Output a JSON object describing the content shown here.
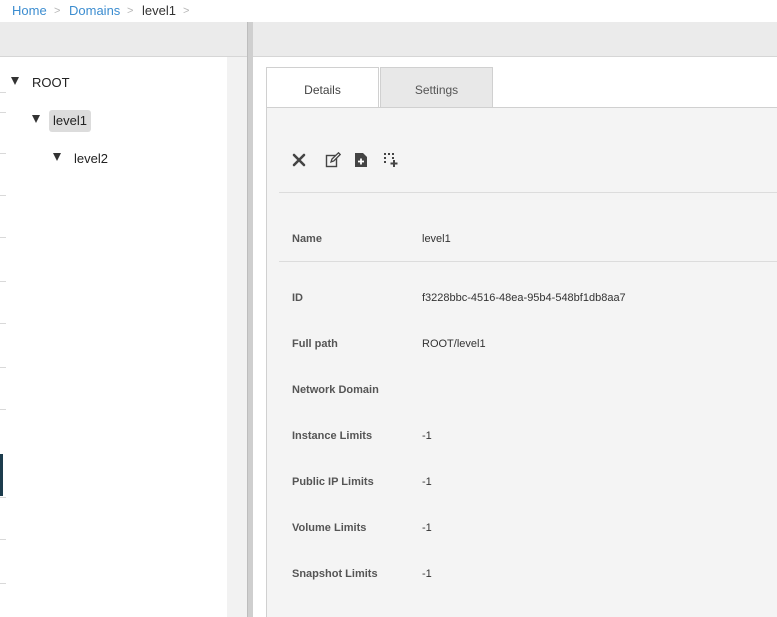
{
  "breadcrumb": {
    "home": "Home",
    "domains": "Domains",
    "current": "level1",
    "separator": ">"
  },
  "tree": {
    "root": "ROOT",
    "level1": "level1",
    "level2": "level2"
  },
  "tabs": {
    "details": "Details",
    "settings": "Settings"
  },
  "toolbar": {
    "icons": [
      "close-icon",
      "edit-icon",
      "add-document-icon",
      "add-subdomain-icon"
    ]
  },
  "details": {
    "name_label": "Name",
    "name_value": "level1",
    "id_label": "ID",
    "id_value": "f3228bbc-4516-48ea-95b4-548bf1db8aa7",
    "full_path_label": "Full path",
    "full_path_value": "ROOT/level1",
    "network_domain_label": "Network Domain",
    "network_domain_value": "",
    "instance_limits_label": "Instance Limits",
    "instance_limits_value": "-1",
    "public_ip_limits_label": "Public IP Limits",
    "public_ip_limits_value": "-1",
    "volume_limits_label": "Volume Limits",
    "volume_limits_value": "-1",
    "snapshot_limits_label": "Snapshot Limits",
    "snapshot_limits_value": "-1"
  },
  "colors": {
    "link": "#3c8dd0",
    "active_marker": "#1c3c4d",
    "selected_node": "#dcdcdc"
  }
}
